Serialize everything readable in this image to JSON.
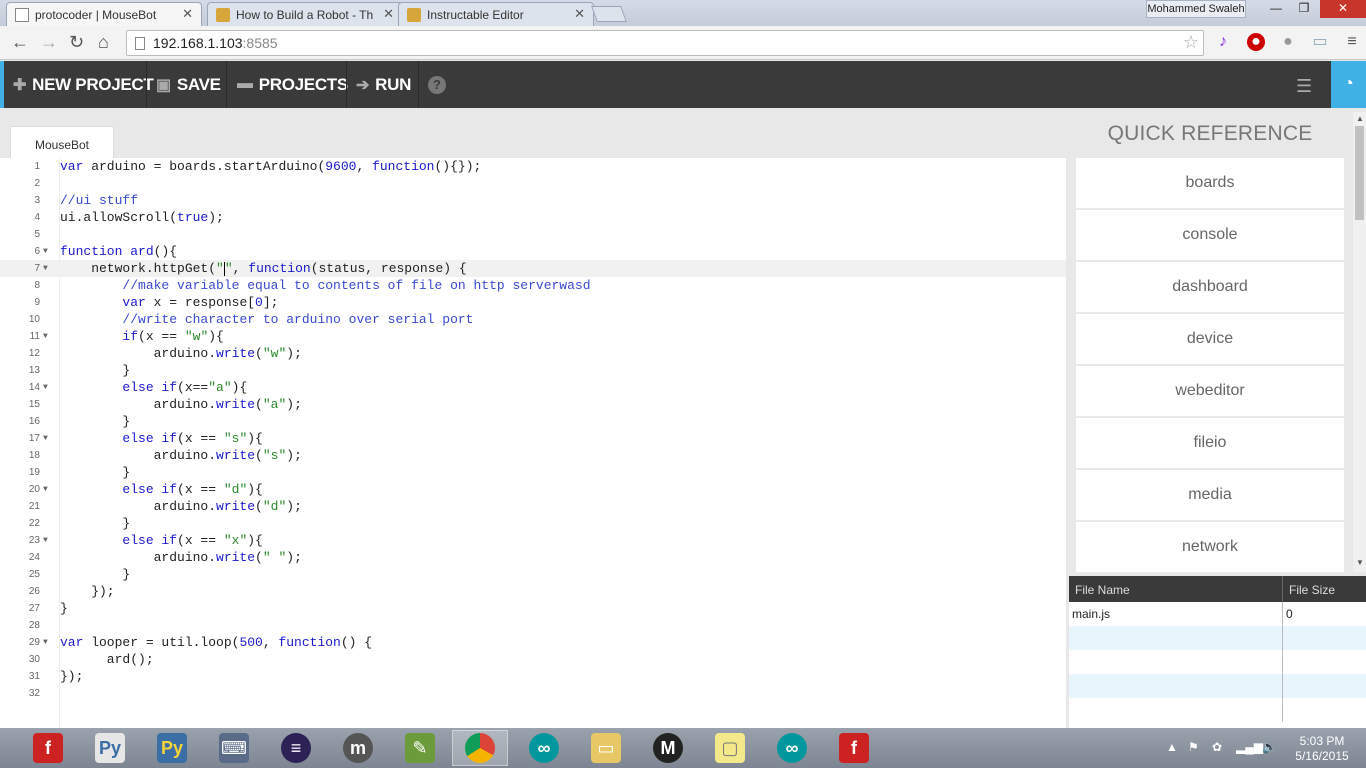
{
  "browser": {
    "tabs": [
      {
        "title": "protocoder | MouseBot"
      },
      {
        "title": "How to Build a Robot - Th"
      },
      {
        "title": "Instructable Editor"
      }
    ],
    "user": "Mohammed Swaleh",
    "url_host": "192.168.1.103",
    "url_port": ":8585"
  },
  "appbar": {
    "new_project": "NEW PROJECT",
    "save": "SAVE",
    "projects": "PROJECTS",
    "run": "RUN",
    "help": "?"
  },
  "editor": {
    "tab": "MouseBot",
    "lines": [
      "1",
      "2",
      "3",
      "4",
      "5",
      "6",
      "7",
      "8",
      "9",
      "10",
      "11",
      "12",
      "13",
      "14",
      "15",
      "16",
      "17",
      "18",
      "19",
      "20",
      "21",
      "22",
      "23",
      "24",
      "25",
      "26",
      "27",
      "28",
      "29",
      "30",
      "31",
      "32"
    ]
  },
  "quick_reference": {
    "title": "QUICK REFERENCE",
    "items": [
      "boards",
      "console",
      "dashboard",
      "device",
      "webeditor",
      "fileio",
      "media",
      "network"
    ]
  },
  "files": {
    "headers": [
      "File Name",
      "File Size"
    ],
    "rows": [
      {
        "name": "main.js",
        "size": "0"
      }
    ]
  },
  "taskbar": {
    "time": "5:03 PM",
    "date": "5/16/2015"
  },
  "colors": {
    "accent": "#3fb1e5",
    "appbar": "#3a3a3a"
  }
}
